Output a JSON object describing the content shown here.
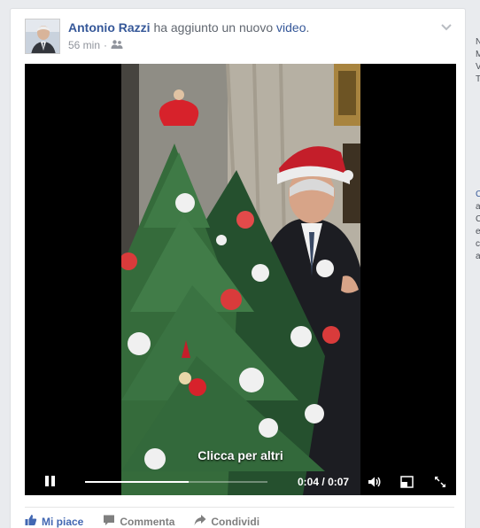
{
  "post": {
    "author": "Antonio Razzi",
    "action_prefix": "ha aggiunto un nuovo",
    "action_object": "video",
    "action_suffix": ".",
    "timestamp": "56 min",
    "separator": "·",
    "privacy_icon": "friends-icon"
  },
  "video": {
    "cta": "Clicca per altri",
    "time_current": "0:04",
    "time_separator": "/",
    "time_total": "0:07",
    "progress": 0.57,
    "state": "playing"
  },
  "actions": {
    "like": "Mi piace",
    "comment": "Commenta",
    "share": "Condividi"
  },
  "sidebar_fragments": [
    "N",
    "M",
    "V",
    "T",
    "C",
    "a",
    "C",
    "e",
    "c",
    "a"
  ],
  "colors": {
    "link": "#365899",
    "like": "#4267b2",
    "meta": "#90949c",
    "background": "#e9ebee"
  }
}
